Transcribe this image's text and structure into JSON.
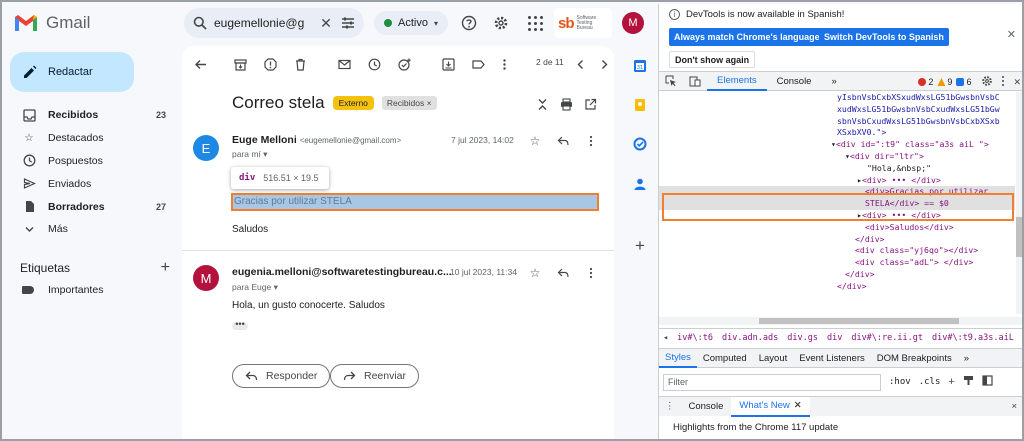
{
  "app": {
    "name": "Gmail"
  },
  "sidebar": {
    "compose_label": "Redactar",
    "items": [
      {
        "label": "Recibidos",
        "count": "23",
        "icon": "inbox-icon",
        "bold": true
      },
      {
        "label": "Destacados",
        "count": "",
        "icon": "star-icon",
        "bold": false
      },
      {
        "label": "Pospuestos",
        "count": "",
        "icon": "clock-icon",
        "bold": false
      },
      {
        "label": "Enviados",
        "count": "",
        "icon": "send-icon",
        "bold": false
      },
      {
        "label": "Borradores",
        "count": "27",
        "icon": "draft-icon",
        "bold": true
      },
      {
        "label": "Más",
        "count": "",
        "icon": "chevron-down-icon",
        "bold": false
      }
    ],
    "labels_title": "Etiquetas",
    "labels_add": "+",
    "labels": [
      {
        "label": "Importantes",
        "icon": "label-icon"
      }
    ]
  },
  "topbar": {
    "search_query": "eugemellonie@g",
    "status_label": "Activo",
    "brand_text": "sb",
    "brand_sub": "Software Testing Bureau",
    "avatar_letter": "M"
  },
  "mail": {
    "pager": "2 de 11",
    "subject": "Correo stela",
    "chip_external": "Externo",
    "chip_inbox": "Recibidos ×",
    "messages": [
      {
        "avatar": "E",
        "sender": "Euge Melloni",
        "sender_email": "<eugemellonie@gmail.com>",
        "to": "para mí ▾",
        "date": "7 jul 2023, 14:02",
        "highlighted_line": "Gracias por utilizar STELA",
        "closing": "Saludos"
      },
      {
        "avatar": "M",
        "sender": "eugenia.melloni@softwaretestingbureau.c...",
        "to": "para Euge ▾",
        "date": "10 jul 2023, 11:34",
        "body": "Hola, un gusto conocerte. Saludos",
        "dots": "•••"
      }
    ],
    "tooltip": {
      "tag": "div",
      "size": "516.51 × 19.5"
    },
    "reply_label": "Responder",
    "forward_label": "Reenviar"
  },
  "devtools": {
    "notice": "DevTools is now available in Spanish!",
    "btn_match": "Always match Chrome's language",
    "btn_switch": "Switch DevTools to Spanish",
    "btn_dismiss": "Don't show again",
    "tabs": [
      "Elements",
      "Console",
      "»"
    ],
    "badges": {
      "errors": "2",
      "warnings": "9",
      "info": "6"
    },
    "code_lines": [
      "yIsbnVsbCxbXSxudWxsLG51bGwsbnVsbC",
      "xudWxsLG51bGwsbnVsbCxudWxsLG51bGw",
      "sbnVsbCxudWxsLG51bGwsbnVsbCxbXSxb",
      "XSxbXV0.\">",
      "<div id=\":t9\" class=\"a3s aiL \">",
      "<div dir=\"ltr\">",
      "\"Hola,&nbsp;\"",
      "<div> ••• </div>",
      "<div>Gracias por utilizar",
      "STELA</div> == $0",
      "<div> ••• </div>",
      "<div>Saludos</div>",
      "</div>",
      "<div class=\"yj6qo\"></div>",
      "<div class=\"adL\"> </div>",
      "</div>",
      "</div>"
    ],
    "breadcrumbs": [
      "iv#\\:t6",
      "div.adn.ads",
      "div.gs",
      "div",
      "div#\\:re.ii.gt",
      "div#\\:t9.a3s.aiL",
      "div",
      "div"
    ],
    "subtabs": [
      "Styles",
      "Computed",
      "Layout",
      "Event Listeners",
      "DOM Breakpoints",
      "»"
    ],
    "filter_placeholder": "Filter",
    "filter_hov": ":hov",
    "filter_cls": ".cls",
    "filter_plus": "+",
    "drawer_tabs": [
      "Console",
      "What's New"
    ],
    "drawer_close": "×",
    "highlights": "Highlights from the Chrome 117 update"
  }
}
